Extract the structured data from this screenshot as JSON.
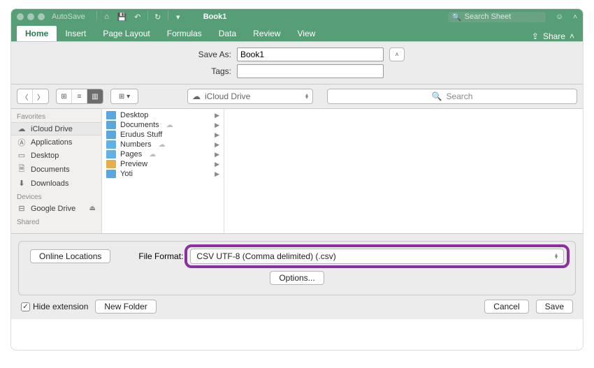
{
  "window": {
    "autosave_label": "AutoSave",
    "doc_title": "Book1",
    "search_placeholder": "Search Sheet"
  },
  "ribbon": {
    "tabs": [
      "Home",
      "Insert",
      "Page Layout",
      "Formulas",
      "Data",
      "Review",
      "View"
    ],
    "share_label": "Share"
  },
  "save_dialog": {
    "save_as_label": "Save As:",
    "tags_label": "Tags:",
    "filename": "Book1",
    "tags_value": ""
  },
  "finder": {
    "location": "iCloud Drive",
    "search_placeholder": "Search",
    "sidebar": {
      "favorites_header": "Favorites",
      "favorites": [
        {
          "icon": "cloud",
          "label": "iCloud Drive",
          "selected": true
        },
        {
          "icon": "apps",
          "label": "Applications"
        },
        {
          "icon": "desktop",
          "label": "Desktop"
        },
        {
          "icon": "doc",
          "label": "Documents"
        },
        {
          "icon": "down",
          "label": "Downloads"
        }
      ],
      "devices_header": "Devices",
      "devices": [
        {
          "icon": "drive",
          "label": "Google Drive",
          "eject": true
        }
      ],
      "shared_header": "Shared"
    },
    "column1": [
      {
        "label": "Desktop",
        "cloud": false
      },
      {
        "label": "Documents",
        "cloud": true
      },
      {
        "label": "Erudus Stuff",
        "cloud": false
      },
      {
        "label": "Numbers",
        "cloud": true
      },
      {
        "label": "Pages",
        "cloud": true
      },
      {
        "label": "Preview",
        "cloud": false
      },
      {
        "label": "Yoti",
        "cloud": false
      }
    ]
  },
  "footer": {
    "online_locations_label": "Online Locations",
    "file_format_label": "File Format:",
    "file_format_value": "CSV UTF-8 (Comma delimited) (.csv)",
    "options_label": "Options...",
    "hide_ext_label": "Hide extension",
    "hide_ext_checked": true,
    "new_folder_label": "New Folder",
    "cancel_label": "Cancel",
    "save_label": "Save"
  }
}
